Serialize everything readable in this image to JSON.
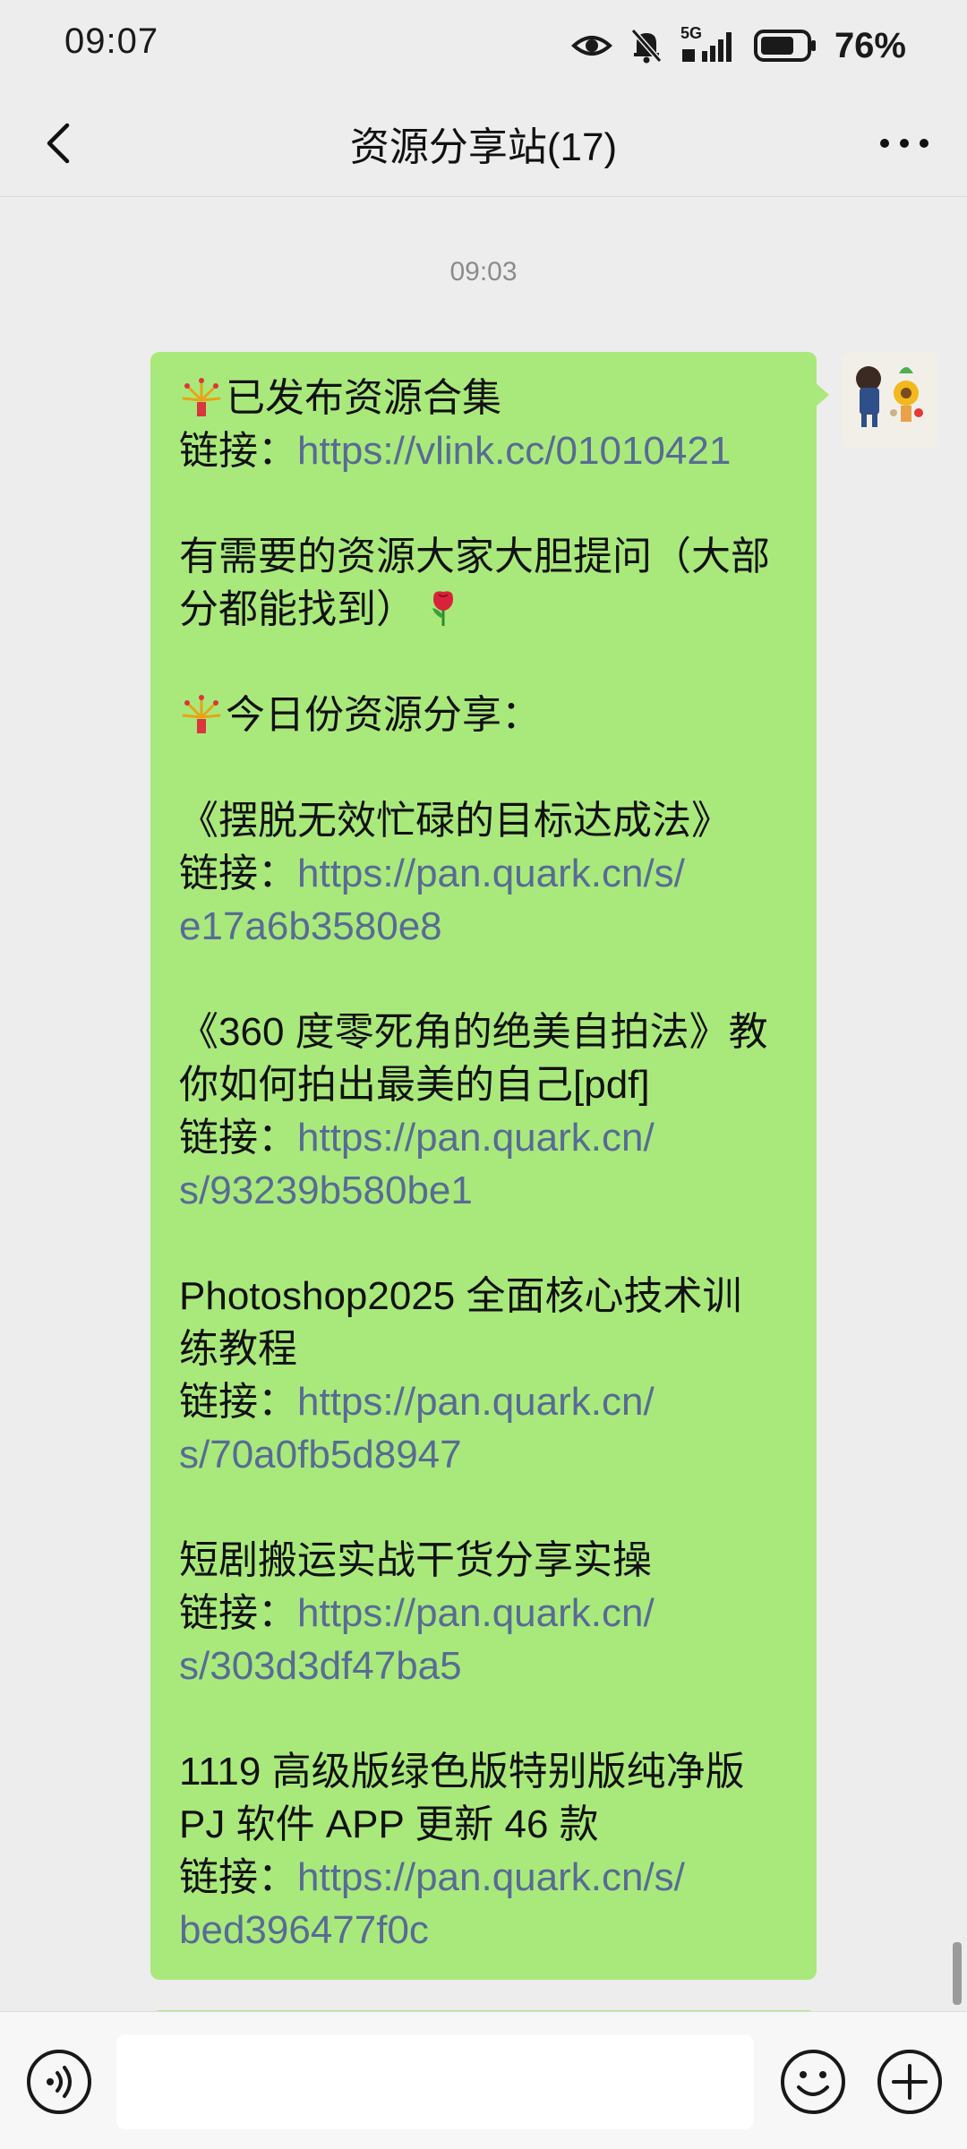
{
  "status": {
    "time": "09:07",
    "network": "5G",
    "battery_pct": "76%",
    "battery_level": 0.76
  },
  "header": {
    "title": "资源分享站(17)"
  },
  "chat": {
    "timestamp": "09:03",
    "message": {
      "l1": "已发布资源合集",
      "l2_label": "链接：",
      "l2_link": "https://vlink.cc/01010421",
      "l3a": "有需要的资源大家大胆提问（大部",
      "l3b": "分都能找到）",
      "l4": "今日份资源分享：",
      "i1_title": "《摆脱无效忙碌的目标达成法》",
      "i1_label": "链接：",
      "i1_link_a": "https://pan.quark.cn/s/",
      "i1_link_b": "e17a6b3580e8",
      "i2_title_a": "《360 度零死角的绝美自拍法》教",
      "i2_title_b": "你如何拍出最美的自己[pdf]",
      "i2_label": "链接：",
      "i2_link_a": "https://pan.quark.cn/",
      "i2_link_b": "s/93239b580be1",
      "i3_title_a": "Photoshop2025 全面核心技术训",
      "i3_title_b": "练教程",
      "i3_label": "链接：",
      "i3_link_a": "https://pan.quark.cn/",
      "i3_link_b": "s/70a0fb5d8947",
      "i4_title": "短剧搬运实战干货分享实操",
      "i4_label": "链接：",
      "i4_link_a": "https://pan.quark.cn/",
      "i4_link_b": "s/303d3df47ba5",
      "i5_title_a": "1119 高级版绿色版特别版纯净版",
      "i5_title_b": "PJ 软件 APP 更新 46 款",
      "i5_label": "链接：",
      "i5_link_a": "https://pan.quark.cn/s/",
      "i5_link_b": "bed396477f0c"
    }
  },
  "icons": {
    "back": "chevron-left-icon",
    "more": "more-dots-icon",
    "voice": "voice-icon",
    "emoji": "smiley-icon",
    "plus": "plus-icon",
    "firework": "firework-emoji",
    "rose": "rose-emoji"
  },
  "colors": {
    "bubble": "#a9e97b",
    "link": "#576b95",
    "background": "#ededed"
  }
}
